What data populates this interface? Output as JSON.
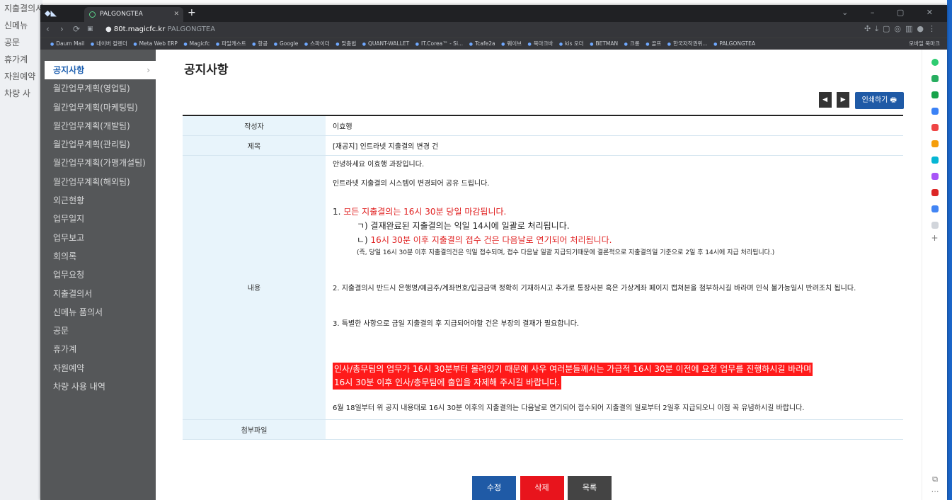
{
  "background_app": {
    "menu": [
      "지출결의서",
      "신메뉴",
      "공문",
      "휴가계",
      "자원예약",
      "차량 사"
    ]
  },
  "browser": {
    "tab_title": "PALGONGTEA",
    "new_tab": "+",
    "url": "80t.magicfc.kr",
    "url_title": "PALGONGTEA",
    "bookmarks": [
      "Daum Mail",
      "네이버 컬렌더",
      "Meta Web ERP",
      "Magicfc",
      "파일캐스트",
      "항공",
      "Google",
      "스파이더",
      "맞춤법",
      "QUANT-WALLET",
      "IT.Corea™ - Si...",
      "Tcafe2a",
      "웨이브",
      "북마크바",
      "kis 오더",
      "BETMAN",
      "크롱",
      "골프",
      "한국저작권위...",
      "PALGONGTEA"
    ],
    "bookmarks_right": "모바일 북마크"
  },
  "sidebar": {
    "items": [
      "공지사항",
      "월간업무계획(영업팀)",
      "월간업무계획(마케팅팀)",
      "월간업무계획(개발팀)",
      "월간업무계획(관리팀)",
      "월간업무계획(가맹개설팀)",
      "월간업무계획(해외팀)",
      "외근현황",
      "업무일지",
      "업무보고",
      "회의록",
      "업무요청",
      "지출결의서",
      "신메뉴 품의서",
      "공문",
      "휴가계",
      "자원예약",
      "차량 사용 내역"
    ]
  },
  "page": {
    "title": "공지사항",
    "prev_label": "◀",
    "next_label": "▶",
    "print_label": "인쇄하기 🖶"
  },
  "notice": {
    "author_label": "작성자",
    "author": "이효행",
    "subject_label": "제목",
    "subject": "[재공지] 인트라넷 지출결의 변경 건",
    "content_label": "내용",
    "greeting": "안녕하세요 이효행 과장입니다.",
    "intro": "인트라넷 지출결의 시스템이 변경되어 공유 드립니다.",
    "item1_prefix": "1. ",
    "item1_red": "모든 지출결의는 16시 30분 당일 마감됩니다.",
    "item1_a": "ㄱ) 결재완료된 지출결의는 익일 14시에 일괄로 처리됩니다.",
    "item1_b_prefix": "ㄴ) ",
    "item1_b_red": "16시 30분 이후 지출결의 접수 건은 다음날로 연기되어 처리됩니다.",
    "item1_c": "(즉, 당일 16시 30분 이후 지출결의건은 익일 접수되며, 접수 다음날 일괄 지급되기때문에 결론적으로 지출결의일 기준으로 2일 후 14시에 지급 처리됩니다.)",
    "item2": "2. 지출결의시 반드시 은행명/예금주/계좌번호/입금금액 정확히 기재하시고 추가로 통장사본 혹은 가상계좌 페이지 캡쳐본을 첨부하시길 바라며 인식 불가능일시 반려조치 됩니다.",
    "item3": "3. 특별한 사항으로 금일 지출결의 후 지급되어야할 건은 부장의 결재가 필요합니다.",
    "highlight1": "인사/총무팀의 업무가 16시 30분부터 몰려있기 때문에 사우 여러분들께서는 가급적 16시 30분 이전에 요청 업무를 진행하시길 바라며",
    "highlight2": "16시 30분 이후 인사/총무팀에 출입을 자제해 주시길 바랍니다.",
    "footer": "6월 18일부터 위 공지 내용대로 16시 30분 이후의 지출결의는 다음날로 연기되어 접수되어 지출결의 일로부터 2일후 지급되오니 이점 꼭 유념하시길 바랍니다.",
    "attach_label": "첨부파일",
    "attach": ""
  },
  "buttons": {
    "edit": "수정",
    "delete": "삭제",
    "list": "목록"
  },
  "colors": {
    "sidebar_bg": "#555759",
    "header_cell_bg": "#e8f4fb",
    "edit_btn": "#1f5aa6",
    "delete_btn": "#e8141c",
    "list_btn": "#444444",
    "highlight_bg": "#ff1a1a"
  }
}
